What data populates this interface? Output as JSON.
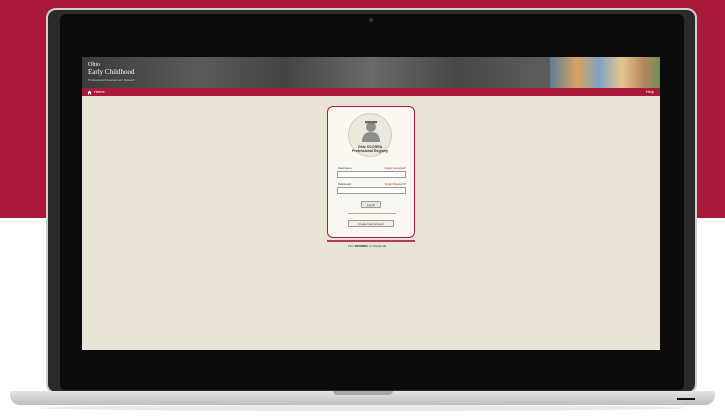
{
  "colors": {
    "brand": "#a8193a",
    "screen_background": "#e8e4d8",
    "laptop_bezel": "#0b0b0b"
  },
  "banner": {
    "logo_line1": "Ohio",
    "logo_line2": "Early Childhood",
    "logo_sub": "Professional Development Network"
  },
  "navbar": {
    "home_label": "Home",
    "help_label": "Help",
    "home_icon": "home-icon"
  },
  "login": {
    "avatar_icon": "user-avatar-icon",
    "portal_title": "Ohio OCCRRA Professional Registry",
    "username_label": "Username",
    "username_value": "",
    "forgot_username": "Forgot Username?",
    "password_label": "Password",
    "password_value": "",
    "forgot_password": "Forgot Password?",
    "login_button": "Log In",
    "apply_button": "Create New Account"
  },
  "footer": {
    "prefix": "Find",
    "brand": "OCCRRA",
    "suffix": "on Facebook"
  }
}
